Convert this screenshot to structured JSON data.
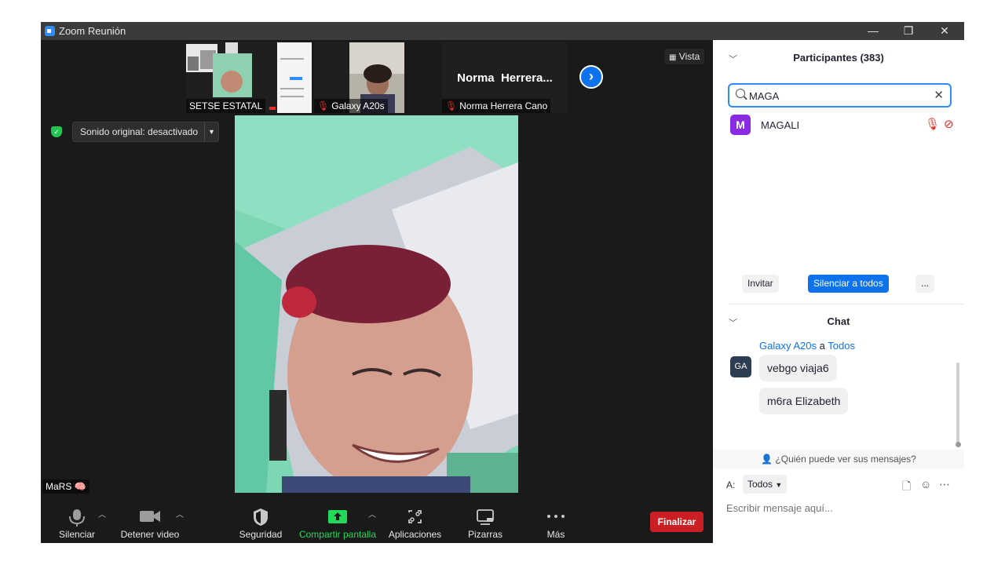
{
  "window": {
    "title": "Zoom Reunión",
    "minimize": "—",
    "restore": "❐",
    "close": "✕"
  },
  "thumbnails": [
    {
      "name": "SETSE ESTATAL",
      "muted": false
    },
    {
      "name": "Galaxy A20s",
      "muted": true
    },
    {
      "name": "Norma Herrera Cano",
      "muted": true,
      "display_name": "Norma  Herrera..."
    }
  ],
  "vista_label": "Vista",
  "sonido_original": "Sonido original: desactivado",
  "speaker_label": "MaRS",
  "toolbar": {
    "mute": "Silenciar",
    "video": "Detener video",
    "security": "Seguridad",
    "share": "Compartir pantalla",
    "apps": "Aplicaciones",
    "whiteboards": "Pizarras",
    "more": "Más",
    "end": "Finalizar"
  },
  "participants": {
    "title": "Participantes (383)",
    "search_value": "MAGA",
    "results": [
      {
        "initial": "M",
        "name": "MAGALI",
        "color": "#8a2be2"
      }
    ],
    "invite": "Invitar",
    "mute_all": "Silenciar a todos",
    "more": "..."
  },
  "chat": {
    "title": "Chat",
    "sender": "Galaxy A20s",
    "to_word": "a",
    "recipient": "Todos",
    "avatar": "GA",
    "messages": [
      "vebgo viaja6",
      "m6ra Elizabeth"
    ],
    "who_sees": "¿Quién puede ver sus mensajes?",
    "to_label": "A:",
    "to_value": "Todos",
    "input_placeholder": "Escribir mensaje aquí..."
  }
}
